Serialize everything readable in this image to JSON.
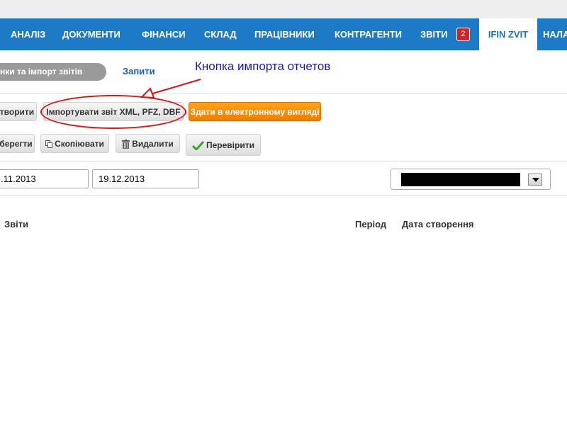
{
  "nav": {
    "items": [
      "АНАЛІЗ",
      "ДОКУМЕНТИ",
      "ФІНАНСИ",
      "СКЛАД",
      "ПРАЦІВНИКИ",
      "КОНТРАГЕНТИ",
      "ЗВІТИ"
    ],
    "reports_badge": "2",
    "active_item": "IFIN ZVIT",
    "overflow_item": "НАЛА"
  },
  "subtabs": {
    "active_label": "нки та імпорт звітів",
    "link_label": "Запити"
  },
  "annotation": {
    "text": "Кнопка импорта отчетов",
    "color": "#1a1aa8",
    "highlight_color": "#e01010"
  },
  "toolbar_primary": {
    "create_label": "творити",
    "import_label": "Імпортувати звіт XML, PFZ, DBF",
    "submit_label": "Здати в електронному вигляді"
  },
  "toolbar_secondary": {
    "save_label": "берегти",
    "copy_label": "Скопіювати",
    "delete_label": "Видалити",
    "check_label": "Перевірити"
  },
  "filters": {
    "date_from": ".11.2013",
    "date_to": "19.12.2013",
    "select_value": ""
  },
  "table": {
    "columns": [
      "Звіти",
      "Період",
      "Дата створення"
    ]
  },
  "colors": {
    "navbar": "#1c7ac7",
    "accent_orange": "#ef7c00",
    "badge": "#d8202a"
  }
}
